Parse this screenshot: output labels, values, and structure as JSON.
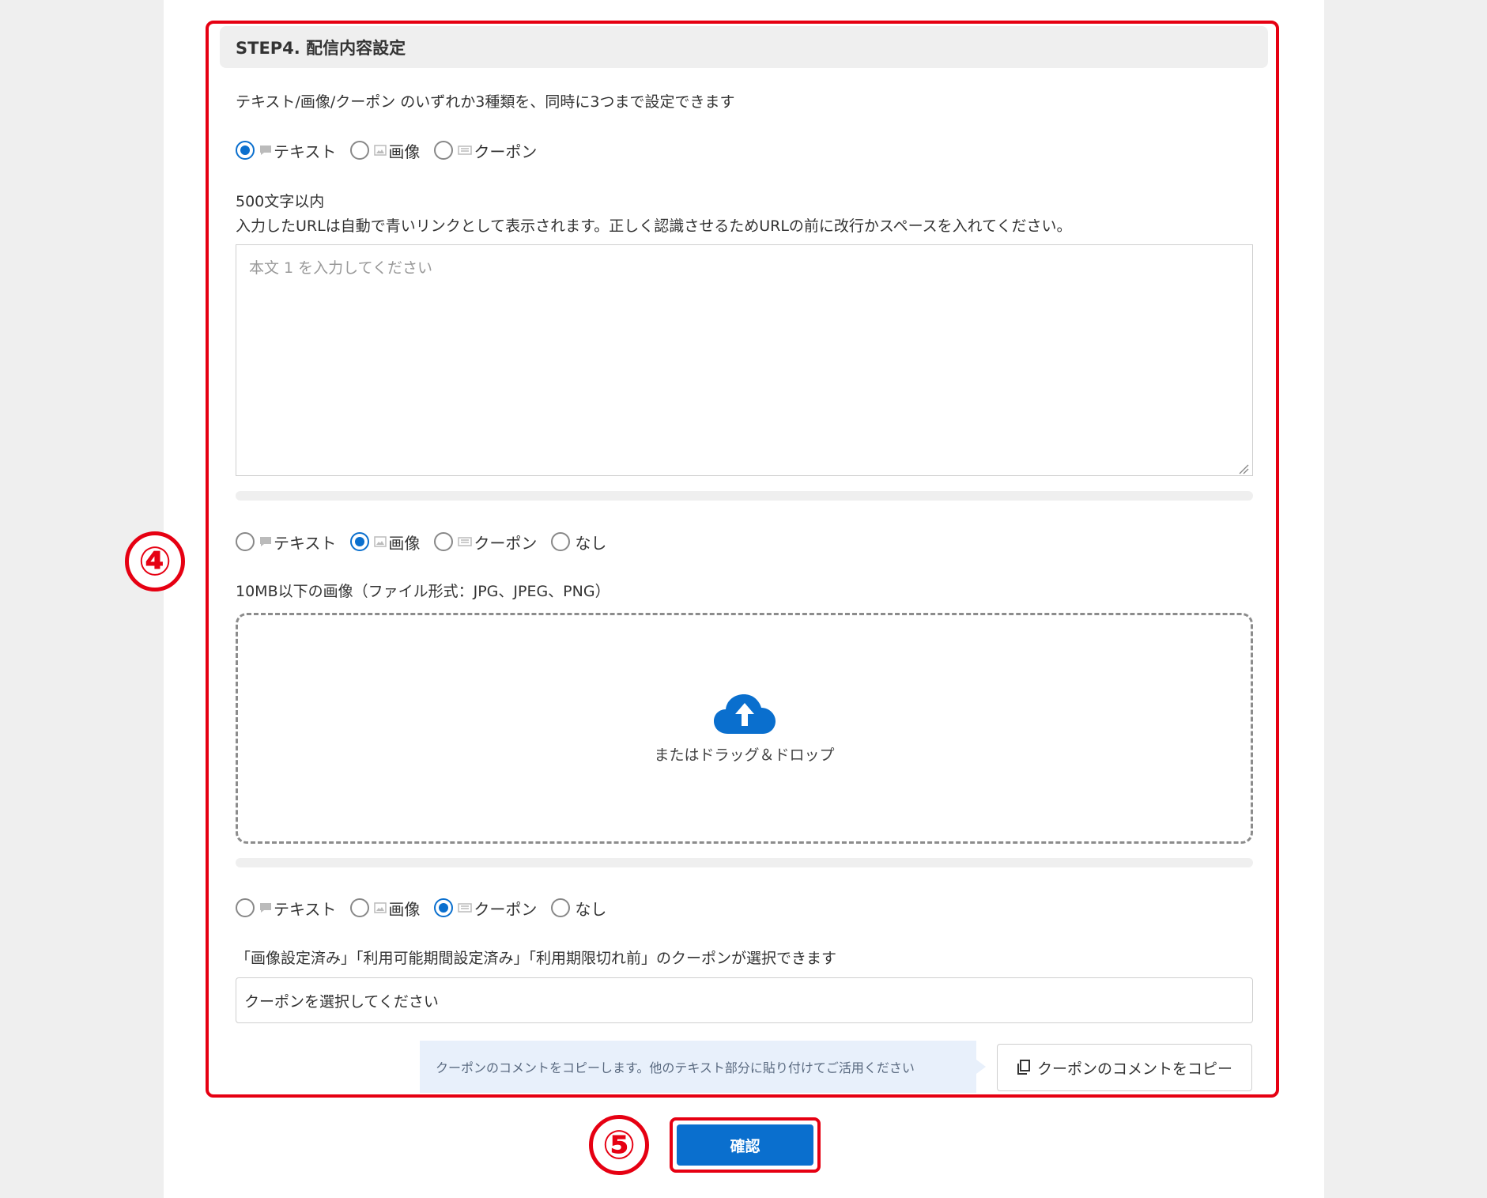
{
  "step": {
    "title": "STEP4. 配信内容設定"
  },
  "intro": "テキスト/画像/クーポン のいずれか3種類を、同時に3つまで設定できます",
  "options": {
    "text": "テキスト",
    "image": "画像",
    "coupon": "クーポン",
    "none": "なし"
  },
  "block1": {
    "selected": "text",
    "limit": "500文字以内",
    "hint": "入力したURLは自動で青いリンクとして表示されます。正しく認識させるためURLの前に改行かスペースを入れてください。",
    "placeholder": "本文 1 を入力してください"
  },
  "block2": {
    "selected": "image",
    "hint": "10MB以下の画像（ファイル形式：JPG、JPEG、PNG）",
    "drop_label": "またはドラッグ＆ドロップ"
  },
  "block3": {
    "selected": "coupon",
    "hint": "「画像設定済み」「利用可能期間設定済み」「利用期限切れ前」のクーポンが選択できます",
    "select_value": "クーポンを選択してください",
    "tooltip": "クーポンのコメントをコピーします。他のテキスト部分に貼り付けてご活用ください",
    "copy_label": "クーポンのコメントをコピー"
  },
  "confirm_label": "確認",
  "markers": [
    "④",
    "⑤"
  ],
  "colors": {
    "accent": "#0a6fce",
    "highlight": "#e60012"
  }
}
